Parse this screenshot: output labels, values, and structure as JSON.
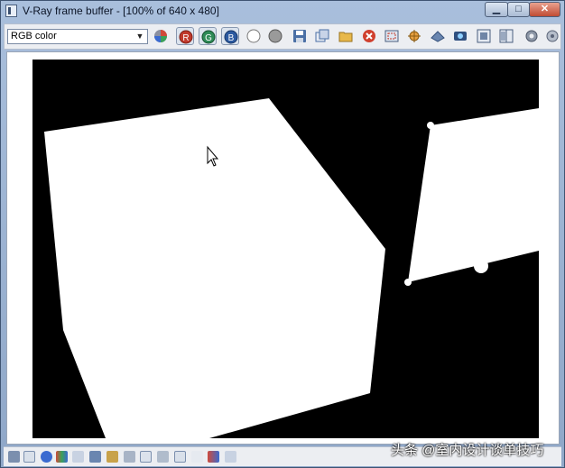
{
  "window": {
    "title": "V-Ray frame buffer - [100% of 640 x 480]"
  },
  "titlebar": {
    "minimize_glyph": "▁",
    "maximize_glyph": "□",
    "close_glyph": "✕"
  },
  "toolbar": {
    "channel_select_value": "RGB color",
    "red_label": "R",
    "green_label": "G",
    "blue_label": "B"
  },
  "watermark": {
    "text": "头条 @室内设计谈单技巧"
  },
  "colors": {
    "accent": "#4a6fa5",
    "red": "#c0392b",
    "green": "#2e8b57",
    "blue": "#2c5aa0",
    "canvas": "#000000"
  },
  "icons": [
    "color-correction-icon",
    "red-channel-icon",
    "green-channel-icon",
    "blue-channel-icon",
    "white-circle-icon",
    "gray-circle-icon",
    "save-icon",
    "duplicate-icon",
    "open-folder-icon",
    "clear-icon",
    "region-render-icon",
    "track-mouse-icon",
    "lens-effects-icon",
    "stereo-icon",
    "history-icon",
    "compare-icon",
    "settings-icon"
  ]
}
